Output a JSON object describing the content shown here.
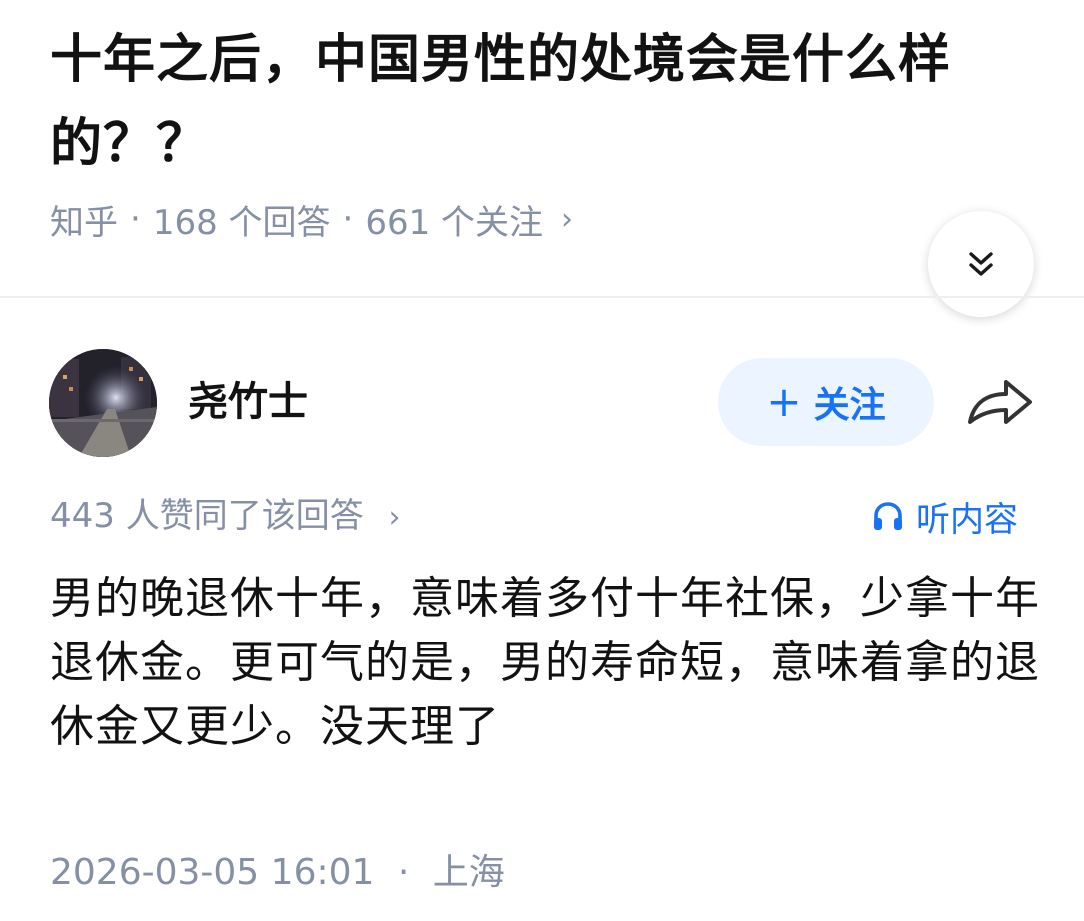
{
  "question": {
    "title": "十年之后，中国男性的处境会是什么样的？？",
    "source": "知乎",
    "separator": "·",
    "answers_count": "168 个回答",
    "followers_count": "661 个关注",
    "meta_chevron": "›"
  },
  "collapse_button": {
    "icon": "double-chevron-down-icon"
  },
  "author": {
    "name": "尧竹士",
    "avatar_icon": "night-street-photo"
  },
  "follow_button": {
    "plus": "+",
    "label": "关注"
  },
  "share": {
    "icon": "share-arrow-icon"
  },
  "answer": {
    "voters_text": "443 人赞同了该回答",
    "voters_chevron": "›",
    "listen_label": "听内容",
    "content": "男的晚退休十年，意味着多付十年社保，少拿十年退休金。更可气的是，男的寿命短，意味着拿的退休金又更少。没天理了",
    "datetime": "2026-03-05 16:01",
    "separator": "·",
    "location": "上海"
  },
  "colors": {
    "accent": "#1772f6",
    "accent_bg": "#ebf4ff",
    "meta_text": "#8590a6",
    "primary_text": "#121212"
  }
}
